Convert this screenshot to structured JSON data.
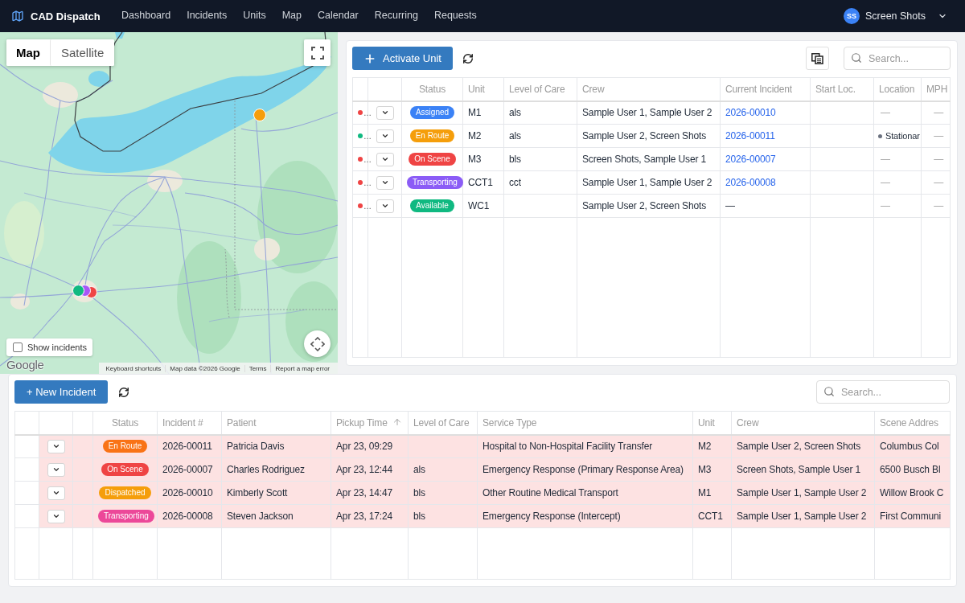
{
  "nav": {
    "brand": "CAD Dispatch",
    "links": [
      {
        "label": "Dashboard",
        "selected": false
      },
      {
        "label": "Incidents",
        "selected": false
      },
      {
        "label": "Units",
        "selected": false
      },
      {
        "label": "Map",
        "selected": false
      },
      {
        "label": "Calendar",
        "selected": false
      },
      {
        "label": "Recurring",
        "selected": false
      },
      {
        "label": "Requests",
        "selected": false
      }
    ],
    "user": {
      "initials": "SS",
      "name": "Screen Shots"
    }
  },
  "map": {
    "tabs": [
      {
        "label": "Map",
        "selected": true
      },
      {
        "label": "Satellite",
        "selected": false
      }
    ],
    "markers": [
      {
        "color": "#f59e0b"
      },
      {
        "color": "#10b981"
      },
      {
        "color": "#a855f7"
      },
      {
        "color": "#ef4444"
      }
    ],
    "show_incidents": {
      "label": "Show incidents",
      "checked": false
    },
    "logo": "Google",
    "attribution": [
      "Keyboard shortcuts",
      "Map data ©2026 Google",
      "Terms",
      "Report a map error"
    ]
  },
  "units": {
    "activate_button": "Activate Unit",
    "search": {
      "placeholder": "Search..."
    },
    "columns": [
      "Status",
      "Unit",
      "Level of Care",
      "Crew",
      "Current Incident",
      "Start Loc.",
      "Location",
      "MPH"
    ],
    "rows": [
      {
        "dot": {
          "color": "#ef4444",
          "text": "…"
        },
        "status": {
          "label": "Assigned",
          "color": "#3b82f6"
        },
        "unit": "M1",
        "level_of_care": "als",
        "crew": "Sample User 1, Sample User 2",
        "current_incident": {
          "kind": "link",
          "text": "2026-00010"
        },
        "location": {
          "kind": "plain",
          "text": "—"
        },
        "mph": "—"
      },
      {
        "dot": {
          "color": "#10b981",
          "text": "…"
        },
        "status": {
          "label": "En Route",
          "color": "#f59e0b"
        },
        "unit": "M2",
        "level_of_care": "als",
        "crew": "Sample User 2, Screen Shots",
        "current_incident": {
          "kind": "link",
          "text": "2026-00011"
        },
        "location": {
          "kind": "dot",
          "text": "Stationar"
        },
        "mph": "—"
      },
      {
        "dot": {
          "color": "#ef4444",
          "text": "…"
        },
        "status": {
          "label": "On Scene",
          "color": "#ef4444"
        },
        "unit": "M3",
        "level_of_care": "bls",
        "crew": "Screen Shots, Sample User 1",
        "current_incident": {
          "kind": "link",
          "text": "2026-00007"
        },
        "location": {
          "kind": "plain",
          "text": "—"
        },
        "mph": "—"
      },
      {
        "dot": {
          "color": "#ef4444",
          "text": "…"
        },
        "status": {
          "label": "Transporting",
          "color": "#8b5cf6"
        },
        "unit": "CCT1",
        "level_of_care": "cct",
        "crew": "Sample User 1, Sample User 2",
        "current_incident": {
          "kind": "link",
          "text": "2026-00008"
        },
        "location": {
          "kind": "plain",
          "text": "—"
        },
        "mph": "—"
      },
      {
        "dot": {
          "color": "#ef4444",
          "text": "…"
        },
        "status": {
          "label": "Available",
          "color": "#10b981"
        },
        "unit": "WC1",
        "crew": "Sample User 2, Screen Shots",
        "current_incident": {
          "kind": "plain",
          "text": "—"
        },
        "location": {
          "kind": "plain",
          "text": "—"
        },
        "mph": "—"
      }
    ]
  },
  "incidents": {
    "new_button": "+ New Incident",
    "search": {
      "placeholder": "Search..."
    },
    "columns": [
      {
        "label": "Status",
        "sorted": false
      },
      {
        "label": "Incident #",
        "sorted": false
      },
      {
        "label": "Patient",
        "sorted": false
      },
      {
        "label": "Pickup Time",
        "sorted": true
      },
      {
        "label": "Level of Care",
        "sorted": false
      },
      {
        "label": "Service Type",
        "sorted": false
      },
      {
        "label": "Unit",
        "sorted": false
      },
      {
        "label": "Crew",
        "sorted": false
      },
      {
        "label": "Scene Addres",
        "sorted": false
      }
    ],
    "rows": [
      {
        "highlighted": true,
        "status": {
          "label": "En Route",
          "color": "#f97316"
        },
        "incident": "2026-00011",
        "patient": "Patricia Davis",
        "pickup_time": "Apr 23, 09:29",
        "service_type": "Hospital to Non-Hospital Facility Transfer",
        "unit": "M2",
        "crew": "Sample User 2, Screen Shots",
        "scene_address": "Columbus Col"
      },
      {
        "highlighted": true,
        "status": {
          "label": "On Scene",
          "color": "#ef4444"
        },
        "incident": "2026-00007",
        "patient": "Charles Rodriguez",
        "pickup_time": "Apr 23, 12:44",
        "level_of_care": "als",
        "service_type": "Emergency Response (Primary Response Area)",
        "unit": "M3",
        "crew": "Screen Shots, Sample User 1",
        "scene_address": "6500 Busch Bl"
      },
      {
        "highlighted": true,
        "status": {
          "label": "Dispatched",
          "color": "#f59e0b"
        },
        "incident": "2026-00010",
        "patient": "Kimberly Scott",
        "pickup_time": "Apr 23, 14:47",
        "level_of_care": "bls",
        "service_type": "Other Routine Medical Transport",
        "unit": "M1",
        "crew": "Sample User 1, Sample User 2",
        "scene_address": "Willow Brook C"
      },
      {
        "highlighted": true,
        "status": {
          "label": "Transporting",
          "color": "#ec4899"
        },
        "incident": "2026-00008",
        "patient": "Steven Jackson",
        "pickup_time": "Apr 23, 17:24",
        "level_of_care": "bls",
        "service_type": "Emergency Response (Intercept)",
        "unit": "CCT1",
        "crew": "Sample User 1, Sample User 2",
        "scene_address": "First Communi"
      }
    ]
  }
}
